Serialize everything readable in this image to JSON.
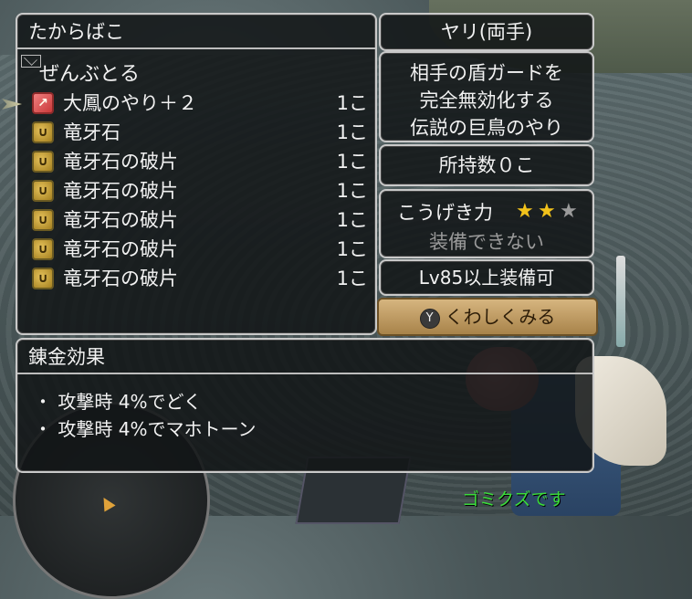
{
  "chest": {
    "title": "たからばこ",
    "take_all": "ぜんぶとる",
    "items": [
      {
        "name": "大鳳のやり＋２",
        "count": "1こ",
        "icon": "spear-icon"
      },
      {
        "name": "竜牙石",
        "count": "1こ",
        "icon": "dragon-fang-stone-icon"
      },
      {
        "name": "竜牙石の破片",
        "count": "1こ",
        "icon": "dragon-fang-shard-icon"
      },
      {
        "name": "竜牙石の破片",
        "count": "1こ",
        "icon": "dragon-fang-shard-icon"
      },
      {
        "name": "竜牙石の破片",
        "count": "1こ",
        "icon": "dragon-fang-shard-icon"
      },
      {
        "name": "竜牙石の破片",
        "count": "1こ",
        "icon": "dragon-fang-shard-icon"
      },
      {
        "name": "竜牙石の破片",
        "count": "1こ",
        "icon": "dragon-fang-shard-icon"
      }
    ]
  },
  "item_detail": {
    "type": "ヤリ(両手)",
    "description": [
      "相手の盾ガードを",
      "完全無効化する",
      "伝説の巨鳥のやり"
    ],
    "owned": "所持数０こ",
    "attack_label": "こうげき力",
    "attack_stars": 2,
    "attack_stars_max": 3,
    "equip_status": "装備できない",
    "level_requirement": "Lv85以上装備可",
    "detail_button_key": "Y",
    "detail_button_label": "くわしくみる"
  },
  "alchemy": {
    "title": "錬金効果",
    "effects": [
      "・ 攻撃時 4%でどく",
      "・ 攻撃時 4%でマホトーン"
    ]
  },
  "status_message": "ゴミクズです",
  "colors": {
    "star_on": "#f2c21b",
    "star_off": "#9a9a9a",
    "status_green": "#3bdc3b",
    "button_gold": "#c09a5f"
  }
}
